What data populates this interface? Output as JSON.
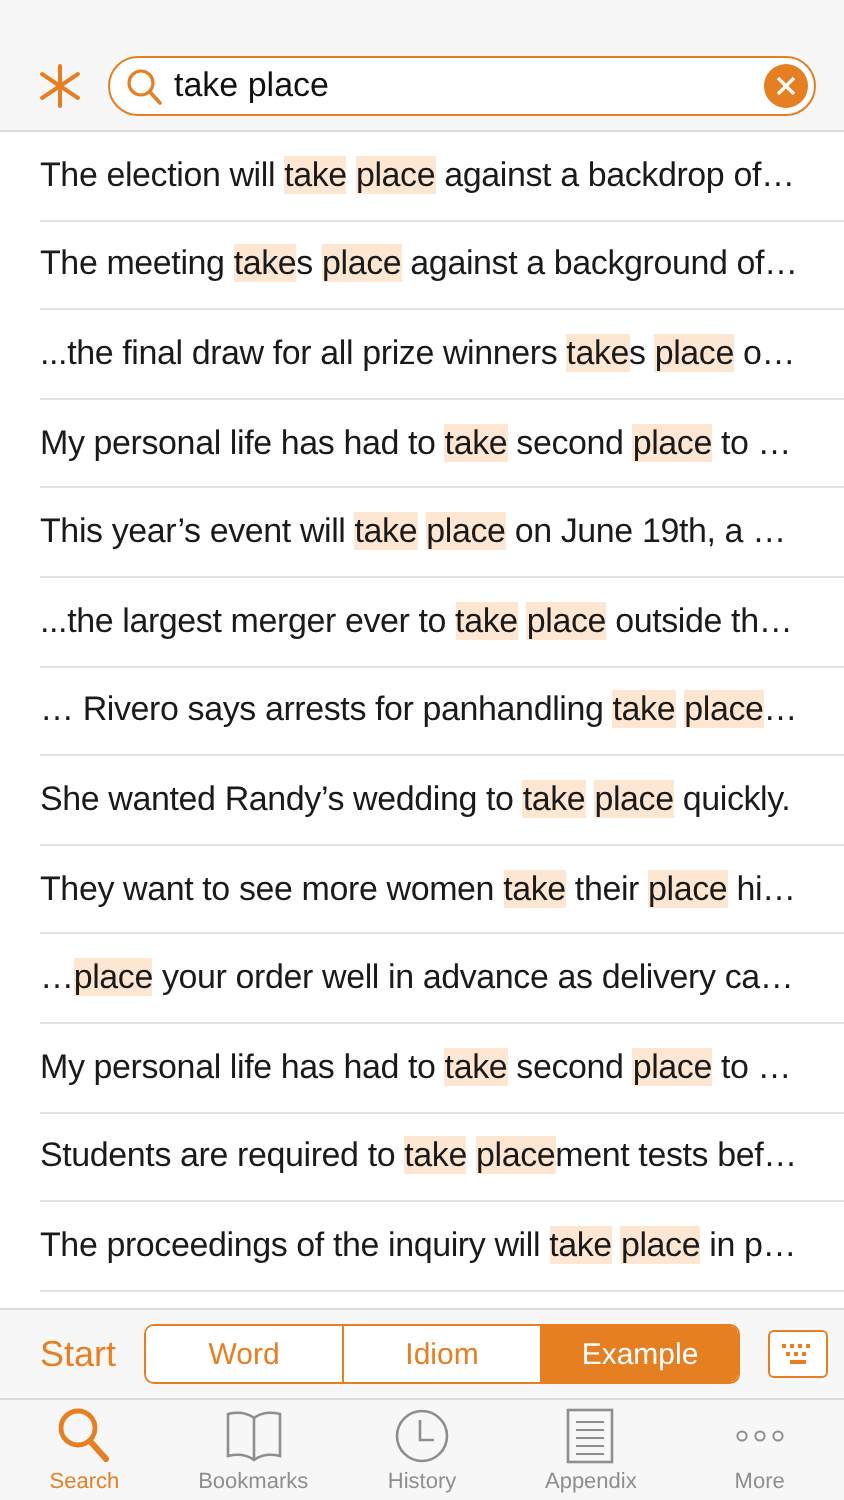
{
  "search": {
    "value": "take place"
  },
  "results": [
    {
      "parts": [
        {
          "text": "The election will ",
          "highlight": false
        },
        {
          "text": "take",
          "highlight": true
        },
        {
          "text": "place",
          "highlight": true
        },
        {
          "text": " against a backdrop of…",
          "highlight": false
        }
      ]
    },
    {
      "parts": [
        {
          "text": "The meeting ",
          "highlight": false
        },
        {
          "text": "take",
          "highlight": true
        },
        {
          "text": "s ",
          "highlight": false
        },
        {
          "text": "place",
          "highlight": true
        },
        {
          "text": " against a background of…",
          "highlight": false
        }
      ]
    },
    {
      "parts": [
        {
          "text": "...the final draw for all prize winners ",
          "highlight": false
        },
        {
          "text": "take",
          "highlight": true
        },
        {
          "text": "s ",
          "highlight": false
        },
        {
          "text": "place",
          "highlight": true
        },
        {
          "text": " o…",
          "highlight": false
        }
      ]
    },
    {
      "parts": [
        {
          "text": "My personal life has had to ",
          "highlight": false
        },
        {
          "text": "take",
          "highlight": true
        },
        {
          "text": " second ",
          "highlight": false
        },
        {
          "text": "place",
          "highlight": true
        },
        {
          "text": " to …",
          "highlight": false
        }
      ]
    },
    {
      "parts": [
        {
          "text": "This year’s event will ",
          "highlight": false
        },
        {
          "text": "take",
          "highlight": true
        },
        {
          "text": "place",
          "highlight": true
        },
        {
          "text": " on June 19th, a …",
          "highlight": false
        }
      ]
    },
    {
      "parts": [
        {
          "text": "...the largest merger ever to ",
          "highlight": false
        },
        {
          "text": "take",
          "highlight": true
        },
        {
          "text": "place",
          "highlight": true
        },
        {
          "text": " outside th…",
          "highlight": false
        }
      ]
    },
    {
      "parts": [
        {
          "text": "… Rivero says arrests for panhandling ",
          "highlight": false
        },
        {
          "text": "take",
          "highlight": true
        },
        {
          "text": "place",
          "highlight": true
        },
        {
          "text": "…",
          "highlight": false
        }
      ]
    },
    {
      "parts": [
        {
          "text": "She wanted Randy’s wedding to ",
          "highlight": false
        },
        {
          "text": "take",
          "highlight": true
        },
        {
          "text": "place",
          "highlight": true
        },
        {
          "text": " quickly.",
          "highlight": false
        }
      ]
    },
    {
      "parts": [
        {
          "text": "They want to see more women ",
          "highlight": false
        },
        {
          "text": "take",
          "highlight": true
        },
        {
          "text": " their ",
          "highlight": false
        },
        {
          "text": "place",
          "highlight": true
        },
        {
          "text": " hi…",
          "highlight": false
        }
      ]
    },
    {
      "parts": [
        {
          "text": "…",
          "highlight": false
        },
        {
          "text": "place",
          "highlight": true
        },
        {
          "text": " your order well in advance as delivery ca…",
          "highlight": false
        }
      ]
    },
    {
      "parts": [
        {
          "text": "My personal life has had to ",
          "highlight": false
        },
        {
          "text": "take",
          "highlight": true
        },
        {
          "text": " second ",
          "highlight": false
        },
        {
          "text": "place",
          "highlight": true
        },
        {
          "text": " to …",
          "highlight": false
        }
      ]
    },
    {
      "parts": [
        {
          "text": "Students are required to ",
          "highlight": false
        },
        {
          "text": "take",
          "highlight": true
        },
        {
          "text": "place",
          "highlight": true
        },
        {
          "text": "ment tests bef…",
          "highlight": false
        }
      ]
    },
    {
      "parts": [
        {
          "text": "The proceedings of the inquiry will ",
          "highlight": false
        },
        {
          "text": "take",
          "highlight": true
        },
        {
          "text": "place",
          "highlight": true
        },
        {
          "text": " in p…",
          "highlight": false
        }
      ]
    }
  ],
  "start_label": "Start",
  "modes": [
    {
      "label": "Word",
      "selected": false
    },
    {
      "label": "Idiom",
      "selected": false
    },
    {
      "label": "Example",
      "selected": true
    }
  ],
  "tab_bar": [
    {
      "kind": "search",
      "label": "Search",
      "selected": true
    },
    {
      "kind": "bookmarks",
      "label": "Bookmarks",
      "selected": false
    },
    {
      "kind": "history",
      "label": "History",
      "selected": false
    },
    {
      "kind": "appendix",
      "label": "Appendix",
      "selected": false
    },
    {
      "kind": "more",
      "label": "More",
      "selected": false
    }
  ]
}
